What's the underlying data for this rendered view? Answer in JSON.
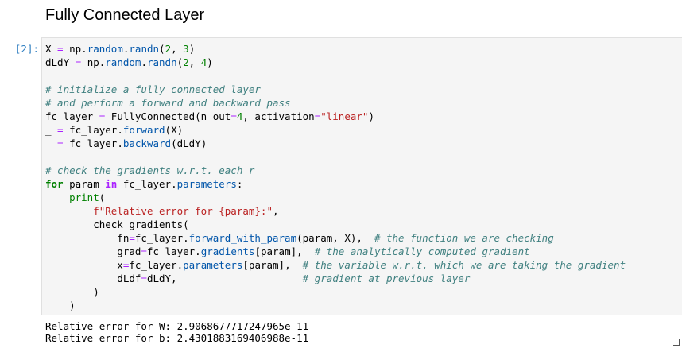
{
  "markdown": {
    "heading": "Fully Connected Layer"
  },
  "cell": {
    "prompt": "[2]:",
    "code_lines": [
      [
        [
          "X",
          ""
        ],
        [
          " = ",
          "eq"
        ],
        [
          "np",
          ""
        ],
        [
          ".",
          ""
        ],
        [
          "random",
          "attr"
        ],
        [
          ".",
          ""
        ],
        [
          "randn",
          "attr"
        ],
        [
          "(",
          ""
        ],
        [
          "2",
          "num"
        ],
        [
          ", ",
          ""
        ],
        [
          "3",
          "num"
        ],
        [
          ")",
          ""
        ]
      ],
      [
        [
          "dLdY",
          ""
        ],
        [
          " = ",
          "eq"
        ],
        [
          "np",
          ""
        ],
        [
          ".",
          ""
        ],
        [
          "random",
          "attr"
        ],
        [
          ".",
          ""
        ],
        [
          "randn",
          "attr"
        ],
        [
          "(",
          ""
        ],
        [
          "2",
          "num"
        ],
        [
          ", ",
          ""
        ],
        [
          "4",
          "num"
        ],
        [
          ")",
          ""
        ]
      ],
      [],
      [
        [
          "# initialize a fully connected layer",
          "c"
        ]
      ],
      [
        [
          "# and perform a forward and backward pass",
          "c"
        ]
      ],
      [
        [
          "fc_layer",
          ""
        ],
        [
          " = ",
          "eq"
        ],
        [
          "FullyConnected(n_out",
          ""
        ],
        [
          "=",
          "eq"
        ],
        [
          "4",
          "num"
        ],
        [
          ", activation",
          ""
        ],
        [
          "=",
          "eq"
        ],
        [
          "\"linear\"",
          "str"
        ],
        [
          ")",
          ""
        ]
      ],
      [
        [
          "_",
          ""
        ],
        [
          " = ",
          "eq"
        ],
        [
          "fc_layer",
          ""
        ],
        [
          ".",
          ""
        ],
        [
          "forward",
          "attr"
        ],
        [
          "(X)",
          ""
        ]
      ],
      [
        [
          "_",
          ""
        ],
        [
          " = ",
          "eq"
        ],
        [
          "fc_layer",
          ""
        ],
        [
          ".",
          ""
        ],
        [
          "backward",
          "attr"
        ],
        [
          "(dLdY)",
          ""
        ]
      ],
      [],
      [
        [
          "# check the gradients w.r.t. each r",
          "c"
        ]
      ],
      [
        [
          "for",
          "kw"
        ],
        [
          " param ",
          ""
        ],
        [
          "in",
          "op"
        ],
        [
          " fc_layer",
          ""
        ],
        [
          ".",
          ""
        ],
        [
          "parameters",
          "attr"
        ],
        [
          ":",
          ""
        ]
      ],
      [
        [
          "    ",
          ""
        ],
        [
          "print",
          "bi"
        ],
        [
          "(",
          ""
        ]
      ],
      [
        [
          "        ",
          ""
        ],
        [
          "f\"Relative error for {param}:\"",
          "str"
        ],
        [
          ",",
          ""
        ]
      ],
      [
        [
          "        check_gradients(",
          ""
        ]
      ],
      [
        [
          "            fn",
          ""
        ],
        [
          "=",
          "eq"
        ],
        [
          "fc_layer",
          ""
        ],
        [
          ".",
          ""
        ],
        [
          "forward_with_param",
          "attr"
        ],
        [
          "(param, X),  ",
          ""
        ],
        [
          "# the function we are checking",
          "c"
        ]
      ],
      [
        [
          "            grad",
          ""
        ],
        [
          "=",
          "eq"
        ],
        [
          "fc_layer",
          ""
        ],
        [
          ".",
          ""
        ],
        [
          "gradients",
          "attr"
        ],
        [
          "[param],  ",
          ""
        ],
        [
          "# the analytically computed gradient",
          "c"
        ]
      ],
      [
        [
          "            x",
          ""
        ],
        [
          "=",
          "eq"
        ],
        [
          "fc_layer",
          ""
        ],
        [
          ".",
          ""
        ],
        [
          "parameters",
          "attr"
        ],
        [
          "[param],  ",
          ""
        ],
        [
          "# the variable w.r.t. which we are taking the gradient",
          "c"
        ]
      ],
      [
        [
          "            dLdf",
          ""
        ],
        [
          "=",
          "eq"
        ],
        [
          "dLdY,                     ",
          ""
        ],
        [
          "# gradient at previous layer",
          "c"
        ]
      ],
      [
        [
          "        )",
          ""
        ]
      ],
      [
        [
          "    )",
          ""
        ]
      ]
    ],
    "output_lines": [
      "Relative error for W: 2.9068677717247965e-11",
      "Relative error for b: 2.4301883169406988e-11"
    ]
  }
}
